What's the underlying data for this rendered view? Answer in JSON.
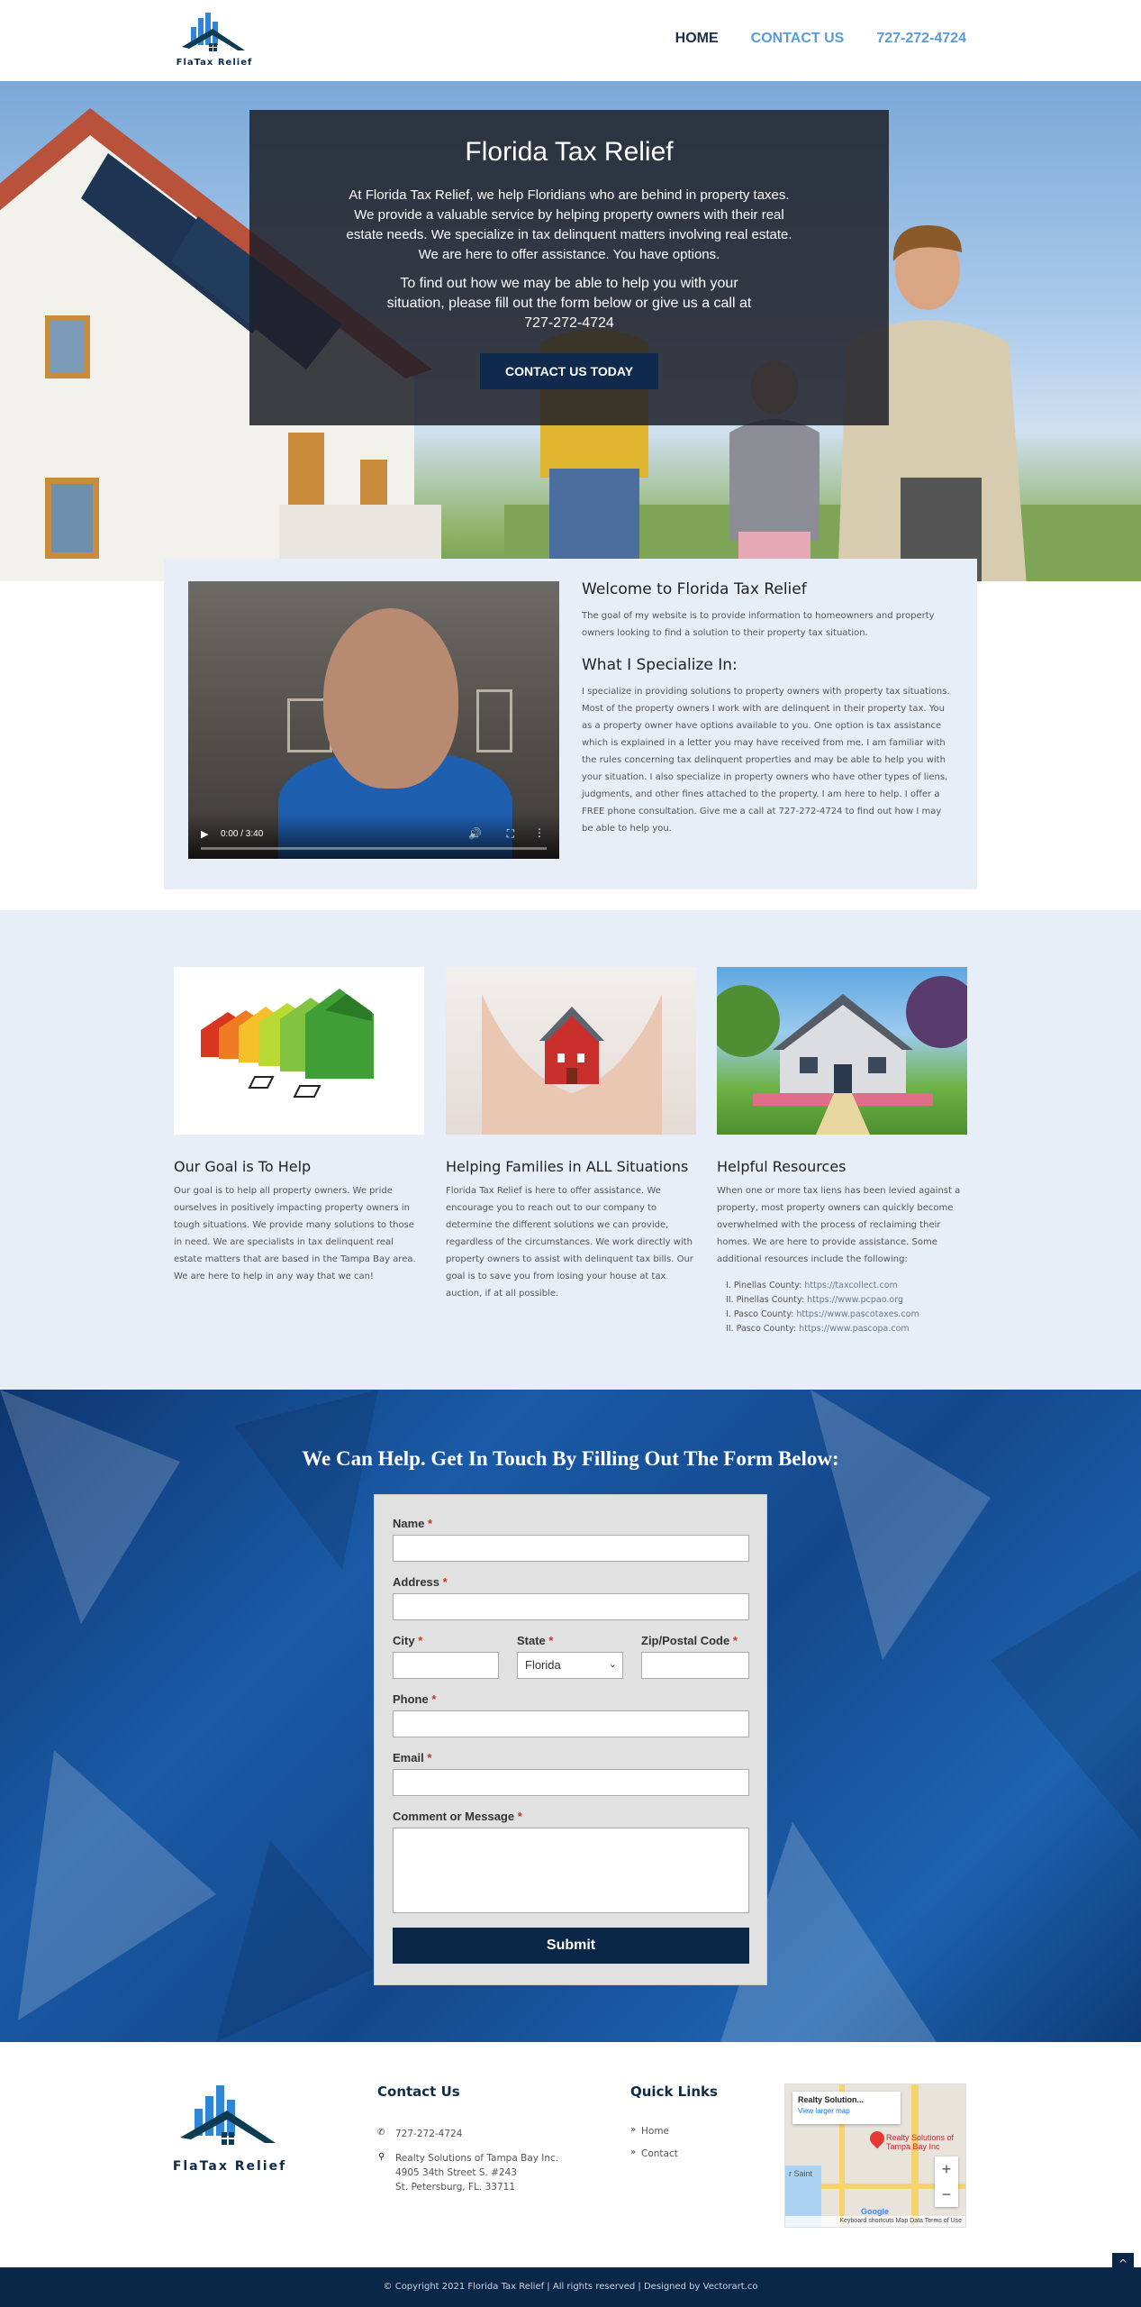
{
  "header": {
    "logo_text": "FlaTax Relief",
    "nav": {
      "home": "HOME",
      "contact": "CONTACT US",
      "phone": "727-272-4724"
    }
  },
  "hero": {
    "title": "Florida Tax Relief",
    "p1": "At Florida Tax Relief, we help Floridians who are behind in property taxes. We provide a valuable service by helping property owners with their real estate needs. We specialize in tax delinquent matters involving real estate. We are here to offer assistance. You have options.",
    "p2": "To find out how we may be able to help you with your situation, please fill out the form below or give us a call at 727-272-4724",
    "button": "CONTACT US TODAY"
  },
  "welcome": {
    "video_time": "0:00 / 3:40",
    "title": "Welcome to Florida Tax Relief",
    "intro": "The goal of my website is to provide information to homeowners and property owners looking to find a solution to their property tax situation.",
    "specialize_title": "What I Specialize In:",
    "specialize_text": "I specialize in providing solutions to property owners with property tax situations. Most of the property owners I work with are delinquent in their property tax. You as a property owner have options available to you. One option is tax assistance which is explained in a letter you may have received from me. I am familiar with the rules concerning tax delinquent properties and may be able to help you with your situation. I also specialize in property owners who have other types of liens, judgments, and other fines attached to the property. I am here to help. I offer a FREE phone consultation. Give me a call at 727-272-4724 to find out how I may be able to help you."
  },
  "columns": [
    {
      "title": "Our Goal is To Help",
      "text": "Our goal is to help all property owners. We pride ourselves in positively impacting property owners in tough situations. We provide many solutions to those in need. We are specialists in tax delinquent real estate matters that are based in the Tampa Bay area. We are here to help in any way that we can!"
    },
    {
      "title": "Helping Families in ALL Situations",
      "text": "Florida Tax Relief is here to offer assistance. We encourage you to reach out to our company to determine the different solutions we can provide, regardless of the circumstances. We work directly with property owners to assist with delinquent tax bills. Our goal is to save you from losing your house at tax auction, if at all possible."
    },
    {
      "title": "Helpful Resources",
      "text": "When one or more tax liens has been levied against a property, most property owners can quickly become overwhelmed with the process of reclaiming their homes. We are here to provide assistance. Some additional resources include the following:",
      "resources": [
        {
          "num": "I.",
          "label": "Pinellas County:",
          "url": "https://taxcollect.com"
        },
        {
          "num": "II.",
          "label": "Pinellas County:",
          "url": "https://www.pcpao.org"
        },
        {
          "num": "I.",
          "label": "Pasco County:",
          "url": "https://www.pascotaxes.com"
        },
        {
          "num": "II.",
          "label": "Pasco County:",
          "url": "https://www.pascopa.com"
        }
      ]
    }
  ],
  "form": {
    "heading": "We Can Help. Get In Touch By Filling Out The Form Below:",
    "name": "Name",
    "address": "Address",
    "city": "City",
    "state": "State",
    "state_value": "Florida",
    "zip": "Zip/Postal Code",
    "phone": "Phone",
    "email": "Email",
    "comment": "Comment or Message",
    "required": "*",
    "submit": "Submit"
  },
  "footer": {
    "logo_text": "FlaTax Relief",
    "contact_title": "Contact Us",
    "phone": "727-272-4724",
    "company": "Realty Solutions of Tampa Bay Inc.",
    "street": "4905 34th Street S. #243",
    "city": "St. Petersburg, FL. 33711",
    "links_title": "Quick Links",
    "link_home": "Home",
    "link_contact": "Contact",
    "map_card_title": "Realty Solution...",
    "map_card_link": "View larger map",
    "map_pin_label": "Realty Solutions of Tampa Bay Inc",
    "map_area": "r Saint",
    "map_footer": "Keyboard shortcuts   Map Data   Terms of Use",
    "map_google": "Google"
  },
  "copyright": "© Copyright 2021 Florida Tax Relief | All rights reserved | Designed by Vectorart.co"
}
